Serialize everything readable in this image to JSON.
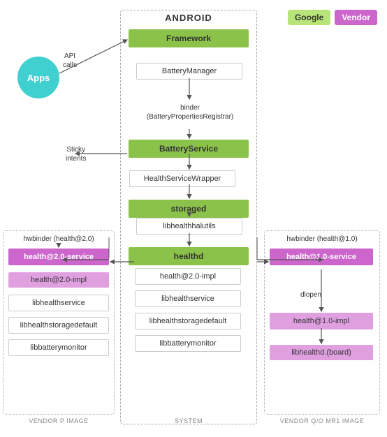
{
  "legend": {
    "google_label": "Google",
    "vendor_label": "Vendor"
  },
  "android_title": "ANDROID",
  "cols": {
    "vendor_p": "VENDOR P IMAGE",
    "system": "SYSTEM",
    "vendor_qo": "VENDOR Q/O MR1 IMAGE"
  },
  "boxes": {
    "apps": "Apps",
    "framework": "Framework",
    "battery_manager": "BatteryManager",
    "binder_label": "binder\n(BatteryPropertiesRegistrar)",
    "battery_service": "BatteryService",
    "health_service_wrapper": "HealthServiceWrapper",
    "storaged": "storaged",
    "libhealthhalutils": "libhealthhalutils",
    "healthd": "healthd",
    "health20_impl_sys": "health@2.0-impl",
    "libhealthservice_sys": "libhealthservice",
    "libhealthstoragedefault_sys": "libhealthstoragedefault",
    "libbatterymonitor_sys": "libbatterymonitor",
    "health20_service_vp": "health@2.0-service",
    "health20_impl_vp": "health@2.0-impl",
    "libhealthservice_vp": "libhealthservice",
    "libhealthstoragedefault_vp": "libhealthstoragedefault",
    "libbatterymonitor_vp": "libbatterymonitor",
    "health10_service_vo": "health@1.0-service",
    "health10_impl_vo": "health@1.0-impl",
    "libhealthd_board": "libhealthd.(board)"
  },
  "labels": {
    "api_calls": "API\ncalls",
    "sticky_intents": "Sticky\nintents",
    "hwbinder_20_left": "hwbinder (health@2.0)",
    "hwbinder_10_right": "hwbinder (health@1.0)",
    "dlopen": "dlopen"
  }
}
